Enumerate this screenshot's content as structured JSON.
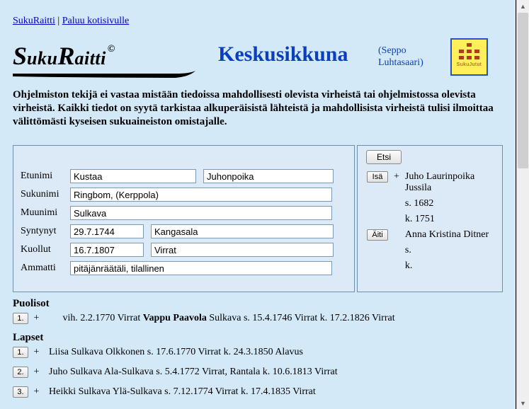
{
  "topnav": {
    "link1": "SukuRaitti",
    "separator": " | ",
    "link2": "Paluu kotisivulle"
  },
  "header": {
    "title": "Keskusikkuna",
    "owner_line1": "(Seppo",
    "owner_line2": "Luhtasaari)",
    "icon_label": "SukuJutut"
  },
  "disclaimer": "Ohjelmiston tekijä ei vastaa mistään tiedoissa mahdollisesti olevista virheistä tai ohjelmistossa olevista virheistä. Kaikki tiedot on syytä tarkistaa alkuperäisistä lähteistä ja mahdollisista virheistä tulisi ilmoittaa välittömästi kyseisen sukuaineiston omistajalle.",
  "form": {
    "labels": {
      "etunimi": "Etunimi",
      "sukunimi": "Sukunimi",
      "muunimi": "Muunimi",
      "syntynyt": "Syntynyt",
      "kuollut": "Kuollut",
      "ammatti": "Ammatti"
    },
    "values": {
      "etunimi1": "Kustaa",
      "etunimi2": "Juhonpoika",
      "sukunimi": "Ringbom, (Kerppola)",
      "muunimi": "Sulkava",
      "syntynyt_date": "29.7.1744",
      "syntynyt_place": "Kangasala",
      "kuollut_date": "16.7.1807",
      "kuollut_place": "Virrat",
      "ammatti": "pitäjänräätäli, tilallinen"
    }
  },
  "parents": {
    "search_btn": "Etsi",
    "father_btn": "Isä",
    "father_plus": "+",
    "father_name": "Juho Laurinpoika Jussila",
    "father_born": "s. 1682",
    "father_died": "k. 1751",
    "mother_btn": "Äiti",
    "mother_name": "Anna Kristina Ditner",
    "mother_born": "s.",
    "mother_died": "k."
  },
  "sections": {
    "spouses_heading": "Puolisot",
    "children_heading": "Lapset"
  },
  "spouses": [
    {
      "num": "1.",
      "plus": "+",
      "prefix": "vih. 2.2.1770 Virrat ",
      "name_bold": "Vappu Paavola",
      "suffix": " Sulkava s. 15.4.1746 Virrat k. 17.2.1826 Virrat"
    }
  ],
  "children": [
    {
      "num": "1.",
      "plus": "+",
      "text": "Liisa Sulkava Olkkonen s. 17.6.1770 Virrat k. 24.3.1850 Alavus"
    },
    {
      "num": "2.",
      "plus": "+",
      "text": "Juho Sulkava Ala-Sulkava s. 5.4.1772 Virrat, Rantala k. 10.6.1813 Virrat"
    },
    {
      "num": "3.",
      "plus": "+",
      "text": "Heikki Sulkava Ylä-Sulkava s. 7.12.1774 Virrat k. 17.4.1835 Virrat"
    }
  ]
}
